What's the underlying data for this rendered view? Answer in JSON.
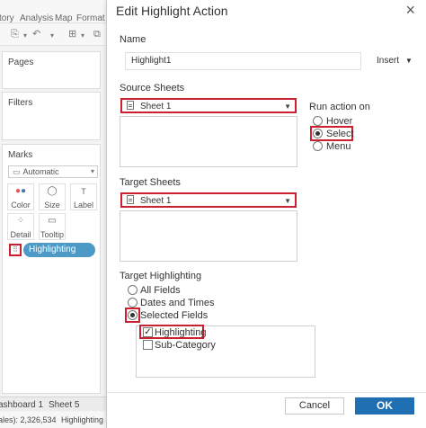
{
  "background": {
    "menu": [
      "tory",
      "Analysis",
      "Map",
      "Format"
    ],
    "toolbar_icons": [
      "data-source-icon",
      "undo-icon",
      "redo-icon",
      "new-worksheet-icon",
      "duplicate-icon"
    ],
    "pages_label": "Pages",
    "filters_label": "Filters",
    "marks": {
      "title": "Marks",
      "type": "Automatic",
      "buttons": [
        {
          "label": "Color",
          "icon": "color-icon"
        },
        {
          "label": "Size",
          "icon": "size-icon"
        },
        {
          "label": "Label",
          "icon": "label-icon"
        },
        {
          "label": "Detail",
          "icon": "detail-icon"
        },
        {
          "label": "Tooltip",
          "icon": "tooltip-icon"
        }
      ],
      "pill": "Highlighting"
    },
    "tabs": [
      "ashboard 1",
      "Sheet 5"
    ],
    "status_left": "ales): 2,326,534",
    "status_right": "Highlighting or"
  },
  "dialog": {
    "title": "Edit Highlight Action",
    "close_symbol": "×",
    "name_label": "Name",
    "name_value": "Highlight1",
    "insert_label": "Insert",
    "source_sheets_label": "Source Sheets",
    "source_sheet_value": "Sheet 1",
    "run_action_label": "Run action on",
    "run_action_options": [
      {
        "label": "Hover",
        "selected": false
      },
      {
        "label": "Select",
        "selected": true
      },
      {
        "label": "Menu",
        "selected": false
      }
    ],
    "target_sheets_label": "Target Sheets",
    "target_sheet_value": "Sheet 1",
    "target_highlighting_label": "Target Highlighting",
    "target_highlighting_options": [
      {
        "label": "All Fields",
        "selected": false
      },
      {
        "label": "Dates and Times",
        "selected": false
      },
      {
        "label": "Selected Fields",
        "selected": true
      }
    ],
    "fields": [
      {
        "label": "Highlighting",
        "checked": true
      },
      {
        "label": "Sub-Category",
        "checked": false
      }
    ],
    "cancel_label": "Cancel",
    "ok_label": "OK",
    "colors": {
      "accent": "#1f6fb2",
      "highlight_red": "#cc1f2f",
      "pill": "#4c9ac5"
    }
  }
}
